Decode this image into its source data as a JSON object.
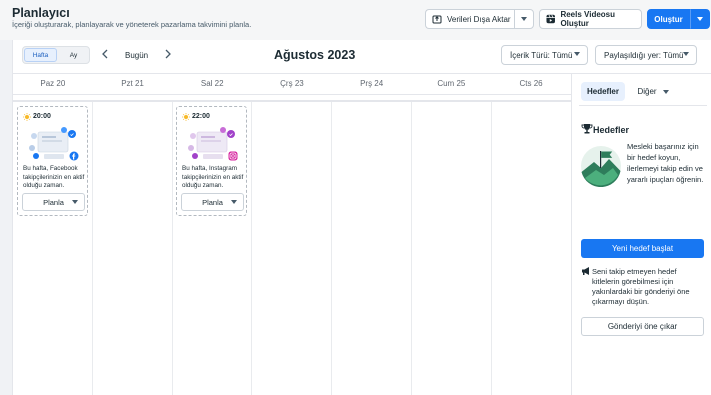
{
  "header": {
    "title": "Planlayıcı",
    "subtitle": "İçeriği oluşturarak, planlayarak ve yöneterek pazarlama takvimini planla.",
    "export_label": "Verileri Dışa Aktar",
    "reels_label": "Reels Videosu Oluştur",
    "create_label": "Oluştur"
  },
  "toolbar": {
    "view_week": "Hafta",
    "view_month": "Ay",
    "today": "Bugün",
    "month_title": "Ağustos 2023",
    "content_type_filter": "İçerik Türü: Tümü",
    "shared_on_filter": "Paylaşıldığı yer: Tümü"
  },
  "calendar": {
    "days": [
      "Paz 20",
      "Pzt 21",
      "Sal 22",
      "Çrş 23",
      "Prş 24",
      "Cum 25",
      "Cts 26"
    ],
    "cards": [
      {
        "time": "20:00",
        "platform": "Facebook",
        "text": "Bu hafta, Facebook takipçilerinizin en aktif olduğu zaman.",
        "button": "Planla"
      },
      {
        "time": "22:00",
        "platform": "Instagram",
        "text": "Bu hafta, Instagram takipçilerinizin en aktif olduğu zaman.",
        "button": "Planla"
      }
    ]
  },
  "sidebar": {
    "tab_goals": "Hedefler",
    "tab_other": "Diğer",
    "goals_title": "Hedefler",
    "goals_text": "Mesleki başarınız için bir hedef koyun, ilerlemeyi takip edin ve yararlı ipuçları öğrenin.",
    "new_goal_button": "Yeni hedef başlat",
    "promo_text": "Seni takip etmeyen hedef kitlelerin görebilmesi için yakınlardaki bir gönderiyi öne çıkarmayı düşün.",
    "boost_button": "Gönderiyi öne çıkar"
  },
  "colors": {
    "primary_blue": "#1877f2",
    "facebook_blue": "#1877f2",
    "instagram_gradient": "#d6249f",
    "goal_green": "#2e7d5b"
  }
}
